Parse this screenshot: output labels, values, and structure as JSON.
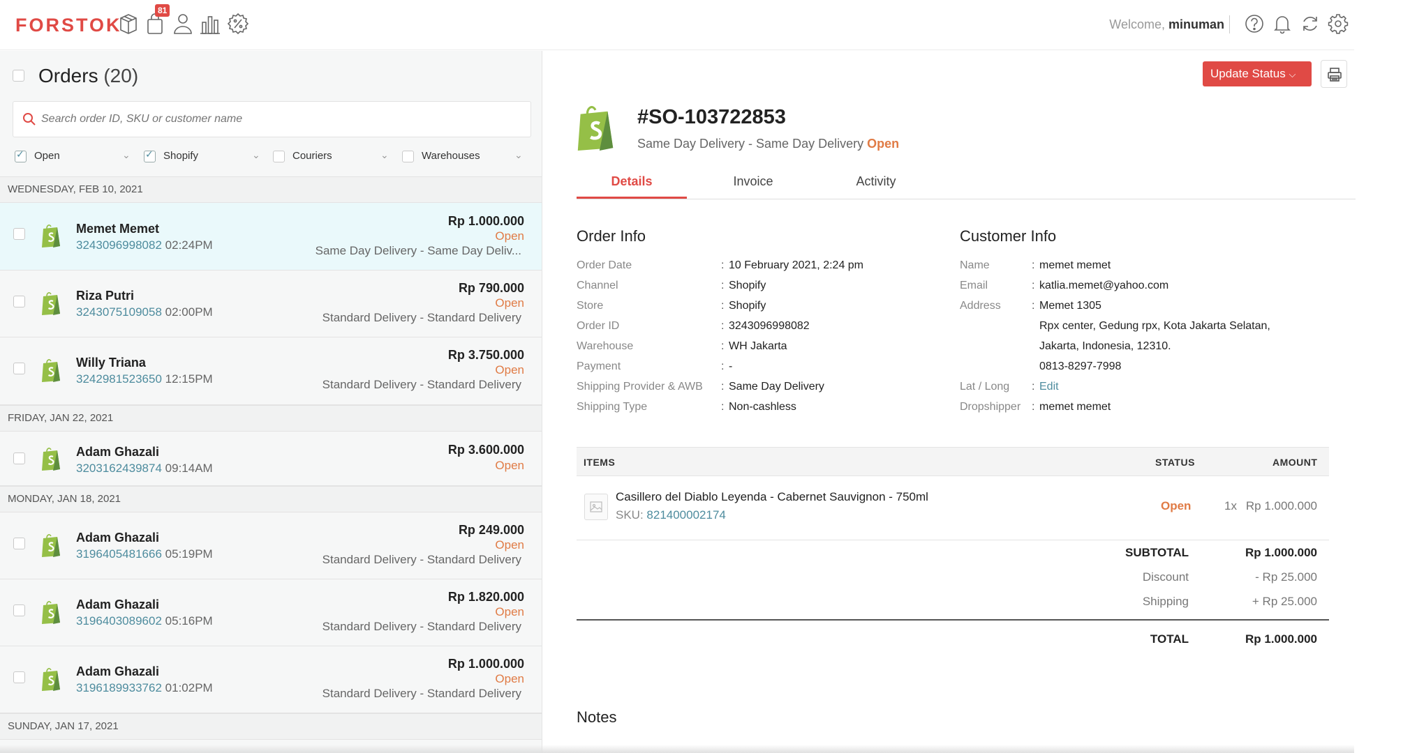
{
  "topbar": {
    "logo": "FORSTOK",
    "notif_count": "81",
    "welcome": "Welcome, ",
    "username": "minuman"
  },
  "orders_panel": {
    "title": "Orders",
    "count": "(20)",
    "search_placeholder": "Search order ID, SKU or customer name",
    "filters": [
      {
        "label": "Open",
        "checked": true
      },
      {
        "label": "Shopify",
        "checked": true
      },
      {
        "label": "Couriers",
        "checked": false
      },
      {
        "label": "Warehouses",
        "checked": false
      }
    ],
    "date_groups": [
      "WEDNESDAY, FEB 10, 2021",
      "FRIDAY, JAN 22, 2021",
      "MONDAY, JAN 18, 2021",
      "SUNDAY, JAN 17, 2021"
    ],
    "orders": [
      {
        "name": "Memet Memet",
        "id": "3243096998082",
        "time": "02:24PM",
        "amount": "Rp 1.000.000",
        "status": "Open",
        "delivery": "Same Day Delivery - Same Day Deliv..."
      },
      {
        "name": "Riza Putri",
        "id": "3243075109058",
        "time": "02:00PM",
        "amount": "Rp 790.000",
        "status": "Open",
        "delivery": "Standard Delivery - Standard Delivery"
      },
      {
        "name": "Willy Triana",
        "id": "3242981523650",
        "time": "12:15PM",
        "amount": "Rp 3.750.000",
        "status": "Open",
        "delivery": "Standard Delivery - Standard Delivery"
      },
      {
        "name": "Adam Ghazali",
        "id": "3203162439874",
        "time": "09:14AM",
        "amount": "Rp 3.600.000",
        "status": "Open",
        "delivery": ""
      },
      {
        "name": "Adam Ghazali",
        "id": "3196405481666",
        "time": "05:19PM",
        "amount": "Rp 249.000",
        "status": "Open",
        "delivery": "Standard Delivery - Standard Delivery"
      },
      {
        "name": "Adam Ghazali",
        "id": "3196403089602",
        "time": "05:16PM",
        "amount": "Rp 1.820.000",
        "status": "Open",
        "delivery": "Standard Delivery - Standard Delivery"
      },
      {
        "name": "Adam Ghazali",
        "id": "3196189933762",
        "time": "01:02PM",
        "amount": "Rp 1.000.000",
        "status": "Open",
        "delivery": "Standard Delivery - Standard Delivery"
      }
    ]
  },
  "detail": {
    "update_status_label": "Update Status",
    "order_number": "#SO-103722853",
    "subtitle": "Same Day Delivery - Same Day Delivery",
    "status": "Open",
    "tabs": [
      "Details",
      "Invoice",
      "Activity"
    ],
    "order_info_title": "Order Info",
    "order_info": [
      {
        "label": "Order Date",
        "value": "10 February 2021, 2:24 pm"
      },
      {
        "label": "Channel",
        "value": "Shopify"
      },
      {
        "label": "Store",
        "value": "Shopify"
      },
      {
        "label": "Order ID",
        "value": "3243096998082"
      },
      {
        "label": "Warehouse",
        "value": "WH Jakarta"
      },
      {
        "label": "Payment",
        "value": "-"
      },
      {
        "label": "Shipping Provider & AWB",
        "value": "Same Day Delivery"
      },
      {
        "label": "Shipping Type",
        "value": "Non-cashless"
      }
    ],
    "customer_info_title": "Customer Info",
    "customer_info": {
      "name_label": "Name",
      "name": "memet memet",
      "email_label": "Email",
      "email": "katlia.memet@yahoo.com",
      "address_label": "Address",
      "address_lines": [
        "Memet 1305",
        "Rpx center, Gedung rpx, Kota Jakarta Selatan,",
        "Jakarta, Indonesia, 12310.",
        "0813-8297-7998"
      ],
      "latlong_label": "Lat / Long",
      "latlong_action": "Edit",
      "dropshipper_label": "Dropshipper",
      "dropshipper": "memet memet"
    },
    "items_table": {
      "headers": [
        "ITEMS",
        "STATUS",
        "AMOUNT"
      ],
      "items": [
        {
          "name": "Casillero del Diablo Leyenda - Cabernet Sauvignon - 750ml",
          "sku_label": "SKU: ",
          "sku": "821400002174",
          "status": "Open",
          "qty": "1x",
          "amount": "Rp 1.000.000"
        }
      ]
    },
    "summary": {
      "subtotal_label": "SUBTOTAL",
      "subtotal": "Rp 1.000.000",
      "discount_label": "Discount",
      "discount": "- Rp 25.000",
      "shipping_label": "Shipping",
      "shipping": "+ Rp 25.000",
      "total_label": "TOTAL",
      "total": "Rp 1.000.000"
    },
    "notes_title": "Notes"
  },
  "colors": {
    "brand": "#e04a45",
    "open_status": "#e07b45",
    "link": "#4e8c9e",
    "shopify_green": "#95bf47"
  }
}
